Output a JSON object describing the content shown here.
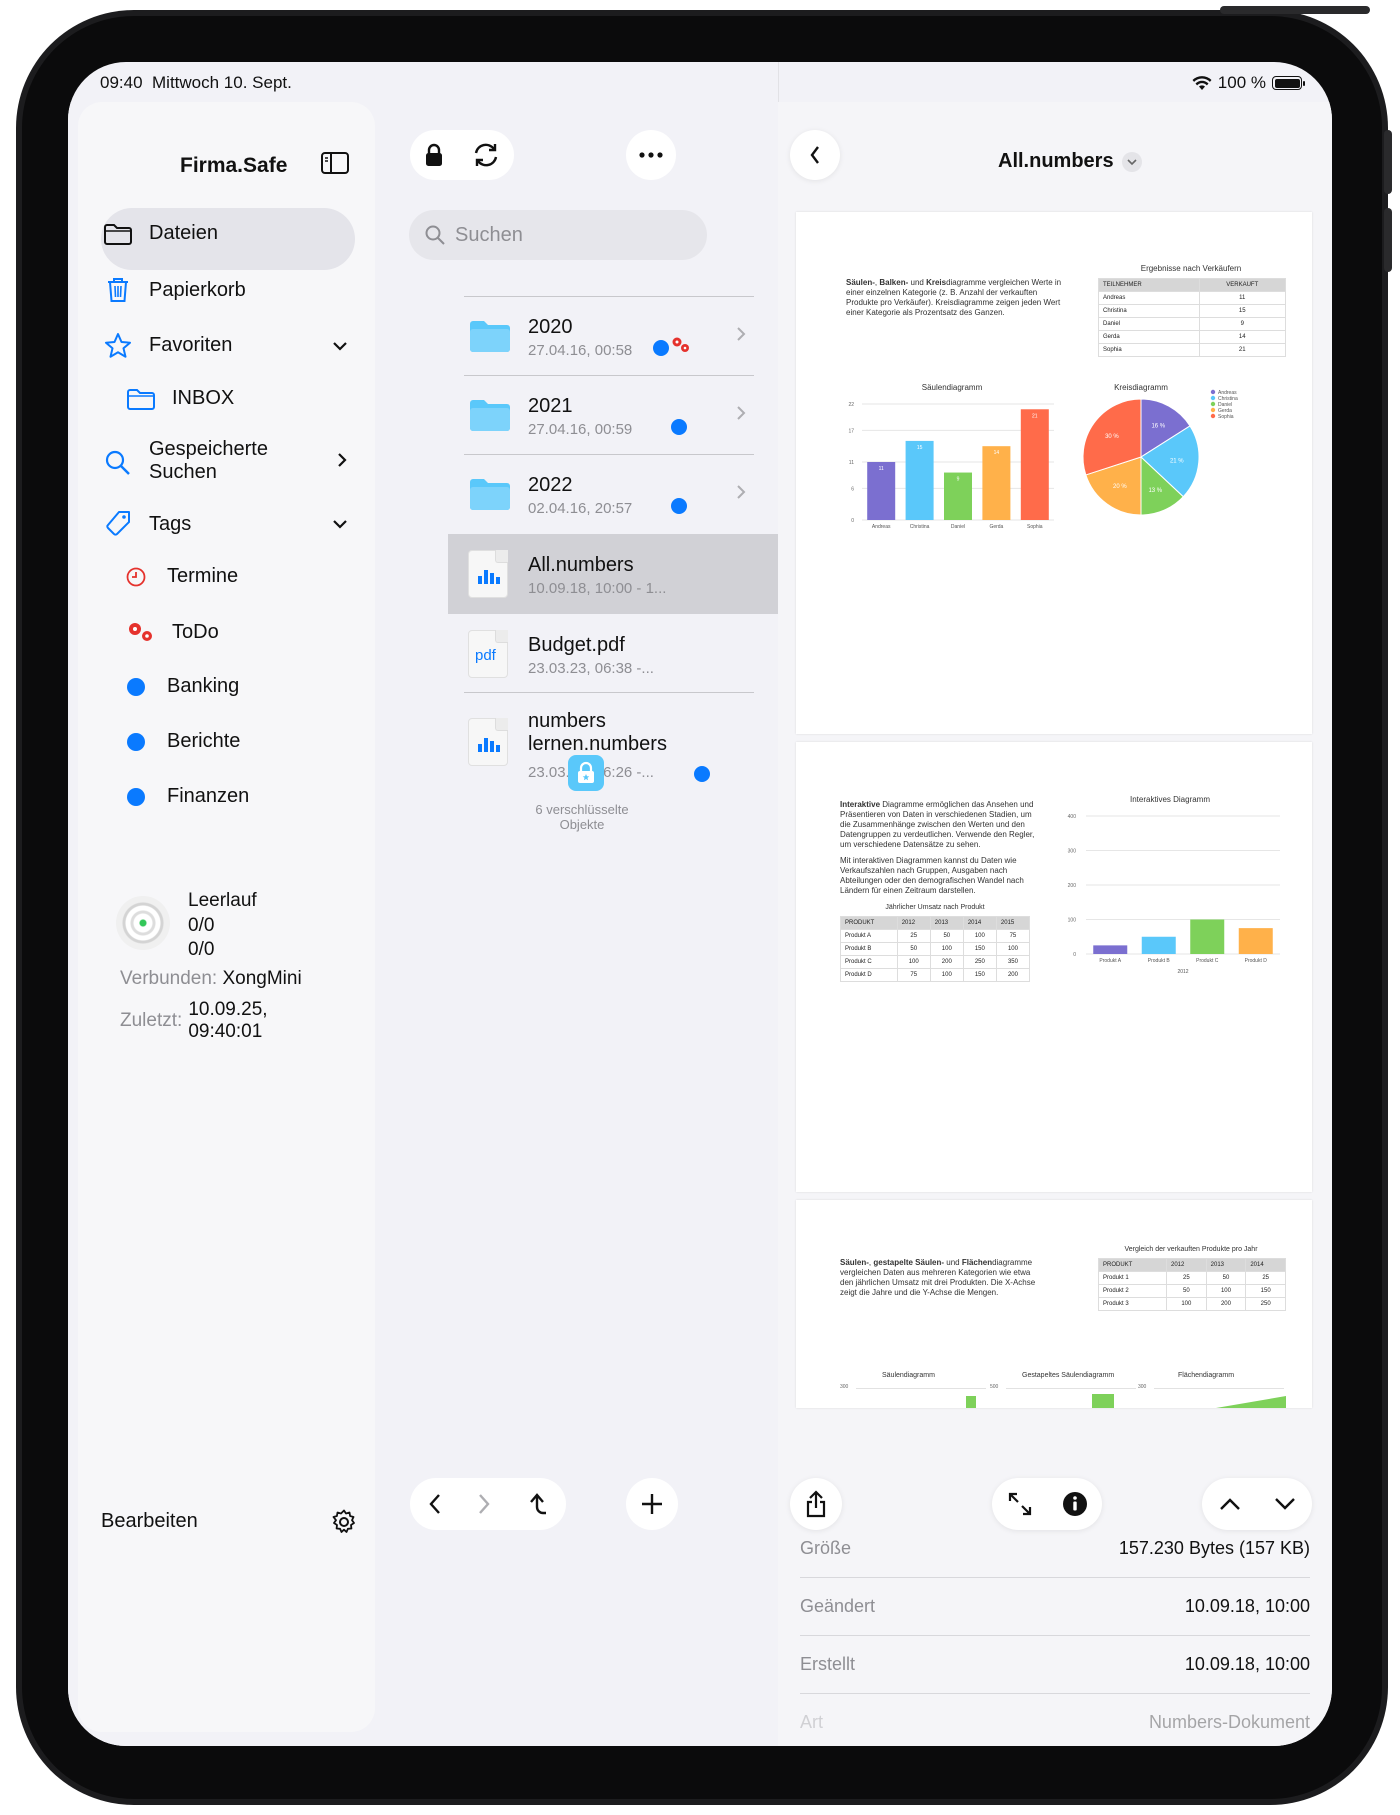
{
  "status": {
    "time": "09:40",
    "date": "Mittwoch 10. Sept.",
    "battery": "100 %"
  },
  "sidebar": {
    "title": "Firma.Safe",
    "items": [
      {
        "label": "Dateien",
        "icon": "folder-icon"
      },
      {
        "label": "Papierkorb",
        "icon": "trash-icon"
      },
      {
        "label": "Favoriten",
        "icon": "star-icon"
      },
      {
        "label": "INBOX",
        "icon": "folder-icon"
      },
      {
        "label": "Gespeicherte",
        "label2": "Suchen",
        "icon": "search-icon"
      },
      {
        "label": "Tags",
        "icon": "tag-icon"
      },
      {
        "label": "Termine",
        "icon": "clock-icon"
      },
      {
        "label": "ToDo",
        "icon": "gears-icon"
      },
      {
        "label": "Banking",
        "icon": "blue-dot-icon"
      },
      {
        "label": "Berichte",
        "icon": "blue-dot-icon"
      },
      {
        "label": "Finanzen",
        "icon": "blue-dot-icon"
      }
    ],
    "sync": {
      "state": "Leerlauf",
      "count1": "0/0",
      "count2": "0/0",
      "connected_label": "Verbunden:",
      "connected_value": "XongMini",
      "last_label": "Zuletzt:",
      "last_value1": "10.09.25,",
      "last_value2": "09:40:01"
    },
    "footer": {
      "edit": "Bearbeiten"
    }
  },
  "list": {
    "search_placeholder": "Suchen",
    "rows": [
      {
        "name": "2020",
        "meta": "27.04.16, 00:58"
      },
      {
        "name": "2021",
        "meta": "27.04.16, 00:59"
      },
      {
        "name": "2022",
        "meta": "02.04.16, 20:57"
      },
      {
        "name": "All.numbers",
        "meta": "10.09.18, 10:00 - 1..."
      },
      {
        "name": "Budget.pdf",
        "meta": "23.03.23, 06:38 -...",
        "icon_text": "pdf"
      },
      {
        "name": "numbers",
        "name2": "lernen.numbers",
        "meta": "23.03.23, 06:26 -..."
      }
    ],
    "encrypted": "6 verschlüsselte Objekte"
  },
  "detail": {
    "title": "All.numbers",
    "page1": {
      "text_bold1": "Säulen-",
      "text_mid1": ", ",
      "text_bold2": "Balken-",
      "text_mid2": " und ",
      "text_bold3": "Kreis",
      "text_rest": "diagramme vergleichen Werte in einer einzelnen Kategorie (z. B. Anzahl der verkauften Produkte pro Verkäufer). Kreisdiagramme zeigen jeden Wert einer Kategorie als Prozentsatz des Ganzen.",
      "table_title": "Ergebnisse nach Verkäufern",
      "table_head": [
        "TEILNEHMER",
        "VERKAUFT"
      ],
      "table_rows": [
        [
          "Andreas",
          "11"
        ],
        [
          "Christina",
          "15"
        ],
        [
          "Daniel",
          "9"
        ],
        [
          "Gerda",
          "14"
        ],
        [
          "Sophia",
          "21"
        ]
      ],
      "bar_title": "Säulendiagramm",
      "pie_title": "Kreisdiagramm",
      "bar_yticks": [
        "22",
        "17",
        "11",
        "6",
        "0"
      ],
      "pie_labels": [
        "16 %",
        "21 %",
        "13 %",
        "20 %",
        "30 %"
      ],
      "legend": [
        "Andreas",
        "Christina",
        "Daniel",
        "Gerda",
        "Sophia"
      ]
    },
    "page2": {
      "text_bold": "Interaktive",
      "text_rest": " Diagramme ermöglichen das Ansehen und Präsentieren von Daten in verschiedenen Stadien, um die Zusammenhänge zwischen den Werten und den Datengruppen zu verdeutlichen. Verwende den Regler, um verschiedene Datensätze zu sehen.",
      "text2": "Mit interaktiven Diagrammen kannst du Daten wie Verkaufszahlen nach Gruppen, Ausgaben nach Abteilungen oder den demografischen Wandel nach Ländern für einen Zeitraum darstellen.",
      "table_title": "Jährlicher Umsatz nach Produkt",
      "table_head": [
        "PRODUKT",
        "2012",
        "2013",
        "2014",
        "2015"
      ],
      "table_rows": [
        [
          "Produkt A",
          "25",
          "50",
          "100",
          "75"
        ],
        [
          "Produkt B",
          "50",
          "100",
          "150",
          "100"
        ],
        [
          "Produkt C",
          "100",
          "200",
          "250",
          "350"
        ],
        [
          "Produkt D",
          "75",
          "100",
          "150",
          "200"
        ]
      ],
      "chart_title": "Interaktives Diagramm",
      "yticks": [
        "400",
        "300",
        "200",
        "100",
        "0"
      ],
      "xticks": [
        "Produkt A",
        "Produkt B",
        "Produkt C",
        "Produkt D"
      ],
      "xlabel": "2012"
    },
    "page3": {
      "text_bold1": "Säulen-",
      "text_mid1": ", ",
      "text_bold2": "gestapelte Säulen-",
      "text_mid2": " und ",
      "text_bold3": "Flächen",
      "text_rest": "diagramme vergleichen Daten aus mehreren Kategorien wie etwa den jährlichen Umsatz mit drei Produkten. Die X-Achse zeigt die Jahre und die Y-Achse die Mengen.",
      "table_title": "Vergleich der verkauften Produkte pro Jahr",
      "table_head": [
        "PRODUKT",
        "2012",
        "2013",
        "2014"
      ],
      "table_rows": [
        [
          "Produkt 1",
          "25",
          "50",
          "25"
        ],
        [
          "Produkt 2",
          "50",
          "100",
          "150"
        ],
        [
          "Produkt 3",
          "100",
          "200",
          "250"
        ]
      ],
      "chart1": "Säulendiagramm",
      "chart2": "Gestapeltes Säulendiagramm",
      "chart3": "Flächendiagramm",
      "ytick_a": "300",
      "ytick_b": "500",
      "ytick_c": "300"
    },
    "info": [
      {
        "key": "Größe",
        "value": "157.230 Bytes (157 KB)"
      },
      {
        "key": "Geändert",
        "value": "10.09.18, 10:00"
      },
      {
        "key": "Erstellt",
        "value": "10.09.18, 10:00"
      },
      {
        "key": "Art",
        "value": "Numbers-Dokument"
      }
    ]
  },
  "chart_data": [
    {
      "type": "bar",
      "title": "Säulendiagramm",
      "categories": [
        "Andreas",
        "Christina",
        "Daniel",
        "Gerda",
        "Sophia"
      ],
      "values": [
        11,
        15,
        9,
        14,
        21
      ],
      "ylim": [
        0,
        22
      ]
    },
    {
      "type": "pie",
      "title": "Kreisdiagramm",
      "categories": [
        "Andreas",
        "Christina",
        "Daniel",
        "Gerda",
        "Sophia"
      ],
      "values": [
        16,
        21,
        13,
        20,
        30
      ]
    },
    {
      "type": "bar",
      "title": "Interaktives Diagramm",
      "categories": [
        "Produkt A",
        "Produkt B",
        "Produkt C",
        "Produkt D"
      ],
      "values": [
        25,
        50,
        100,
        75
      ],
      "xlabel": "2012",
      "ylim": [
        0,
        400
      ]
    }
  ],
  "colors": {
    "accent": "#0a7aff",
    "bar1": "#7b6fd0",
    "bar2": "#5ac8fa",
    "bar3": "#7ed15a",
    "bar4": "#ffb14a",
    "bar5": "#ff6b4a"
  }
}
